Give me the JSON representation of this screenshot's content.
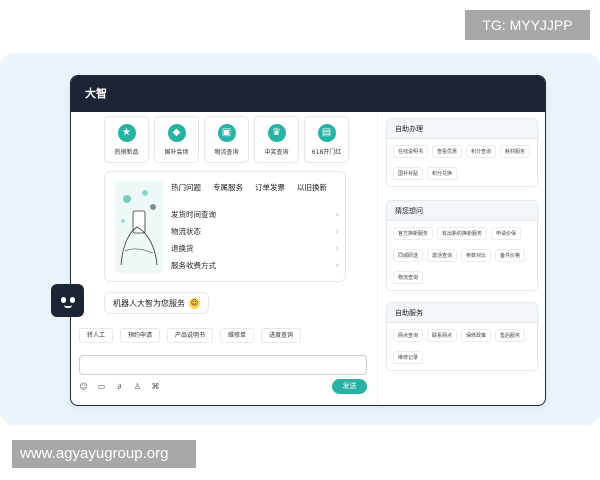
{
  "watermark": {
    "top": "TG: MYYJJPP",
    "bottom": "www.agyayugroup.org"
  },
  "window": {
    "title": "大智"
  },
  "quick_actions": [
    {
      "label": "热销新品",
      "icon": "star-icon"
    },
    {
      "label": "国补会场",
      "icon": "badge-icon"
    },
    {
      "label": "物流查询",
      "icon": "truck-icon"
    },
    {
      "label": "中奖查询",
      "icon": "trophy-icon"
    },
    {
      "label": "618开门红",
      "icon": "gift-icon"
    }
  ],
  "faq": {
    "tabs": [
      "热门问题",
      "专属服务",
      "订单发票",
      "以旧换新"
    ],
    "items": [
      "发货时间查询",
      "物流状态",
      "退换货",
      "服务收费方式"
    ]
  },
  "bot_message": "机器人大智为您服务",
  "service_buttons": [
    "转人工",
    "预约申请",
    "产品说明书",
    "维修单",
    "进度查询"
  ],
  "input": {
    "send_label": "发送"
  },
  "panels": [
    {
      "title": "自助办理",
      "chips": [
        "在线说明书",
        "查看优惠",
        "积分查询",
        "耗材服务",
        "国补补贴",
        "积分兑换"
      ]
    },
    {
      "title": "猜您想问",
      "chips": [
        "官方换新服务",
        "有出新的换新服务",
        "申请价保",
        "同城研送",
        "激活查询",
        "参数对比",
        "备件价格",
        "物流查询"
      ]
    },
    {
      "title": "自助服务",
      "chips": [
        "网点查询",
        "联系网点",
        "保修政策",
        "售后服务",
        "维修记录"
      ]
    }
  ],
  "colors": {
    "accent": "#26b3a4",
    "titlebar": "#1c2437",
    "backdrop": "#eaf5fb"
  }
}
